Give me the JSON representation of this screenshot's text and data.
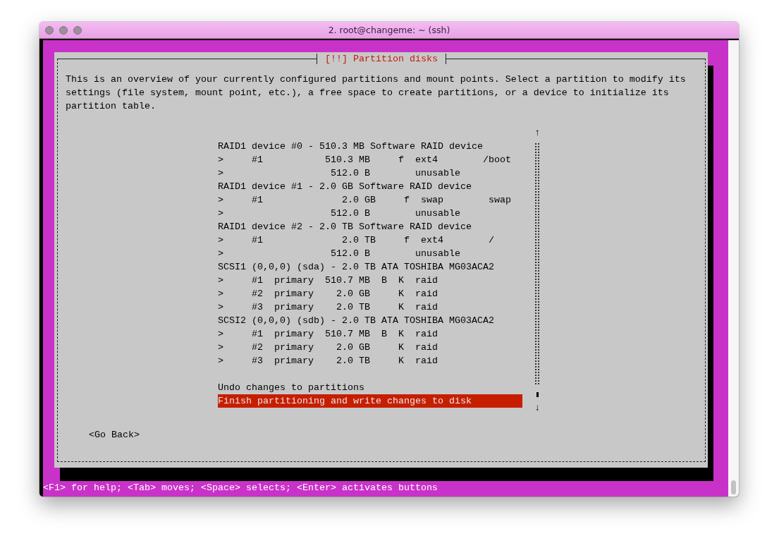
{
  "window": {
    "title": "2. root@changeme: ~ (ssh)"
  },
  "dialog": {
    "title": "[!!] Partition disks",
    "description_lines": [
      "This is an overview of your currently configured partitions and mount points. Select a partition to modify its",
      "settings (file system, mount point, etc.), a free space to create partitions, or a device to initialize its",
      "partition table."
    ],
    "partition_rows": [
      {
        "text": "RAID1 device #0 - 510.3 MB Software RAID device",
        "selected": false
      },
      {
        "text": ">     #1           510.3 MB     f  ext4        /boot",
        "selected": false
      },
      {
        "text": ">                   512.0 B        unusable",
        "selected": false
      },
      {
        "text": "RAID1 device #1 - 2.0 GB Software RAID device",
        "selected": false
      },
      {
        "text": ">     #1              2.0 GB     f  swap        swap",
        "selected": false
      },
      {
        "text": ">                   512.0 B        unusable",
        "selected": false
      },
      {
        "text": "RAID1 device #2 - 2.0 TB Software RAID device",
        "selected": false
      },
      {
        "text": ">     #1              2.0 TB     f  ext4        /",
        "selected": false
      },
      {
        "text": ">                   512.0 B        unusable",
        "selected": false
      },
      {
        "text": "SCSI1 (0,0,0) (sda) - 2.0 TB ATA TOSHIBA MG03ACA2",
        "selected": false
      },
      {
        "text": ">     #1  primary  510.7 MB  B  K  raid",
        "selected": false
      },
      {
        "text": ">     #2  primary    2.0 GB     K  raid",
        "selected": false
      },
      {
        "text": ">     #3  primary    2.0 TB     K  raid",
        "selected": false
      },
      {
        "text": "SCSI2 (0,0,0) (sdb) - 2.0 TB ATA TOSHIBA MG03ACA2",
        "selected": false
      },
      {
        "text": ">     #1  primary  510.7 MB  B  K  raid",
        "selected": false
      },
      {
        "text": ">     #2  primary    2.0 GB     K  raid",
        "selected": false
      },
      {
        "text": ">     #3  primary    2.0 TB     K  raid",
        "selected": false
      }
    ],
    "action_rows": [
      {
        "text": "Undo changes to partitions",
        "selected": false
      },
      {
        "text": "Finish partitioning and write changes to disk",
        "selected": true
      }
    ],
    "scroll_up": "↑",
    "scroll_down": "↓",
    "buttons": [
      {
        "label": "<Go Back>",
        "selected": false
      }
    ]
  },
  "status_bar": "<F1> for help; <Tab> moves; <Space> selects; <Enter> activates buttons"
}
